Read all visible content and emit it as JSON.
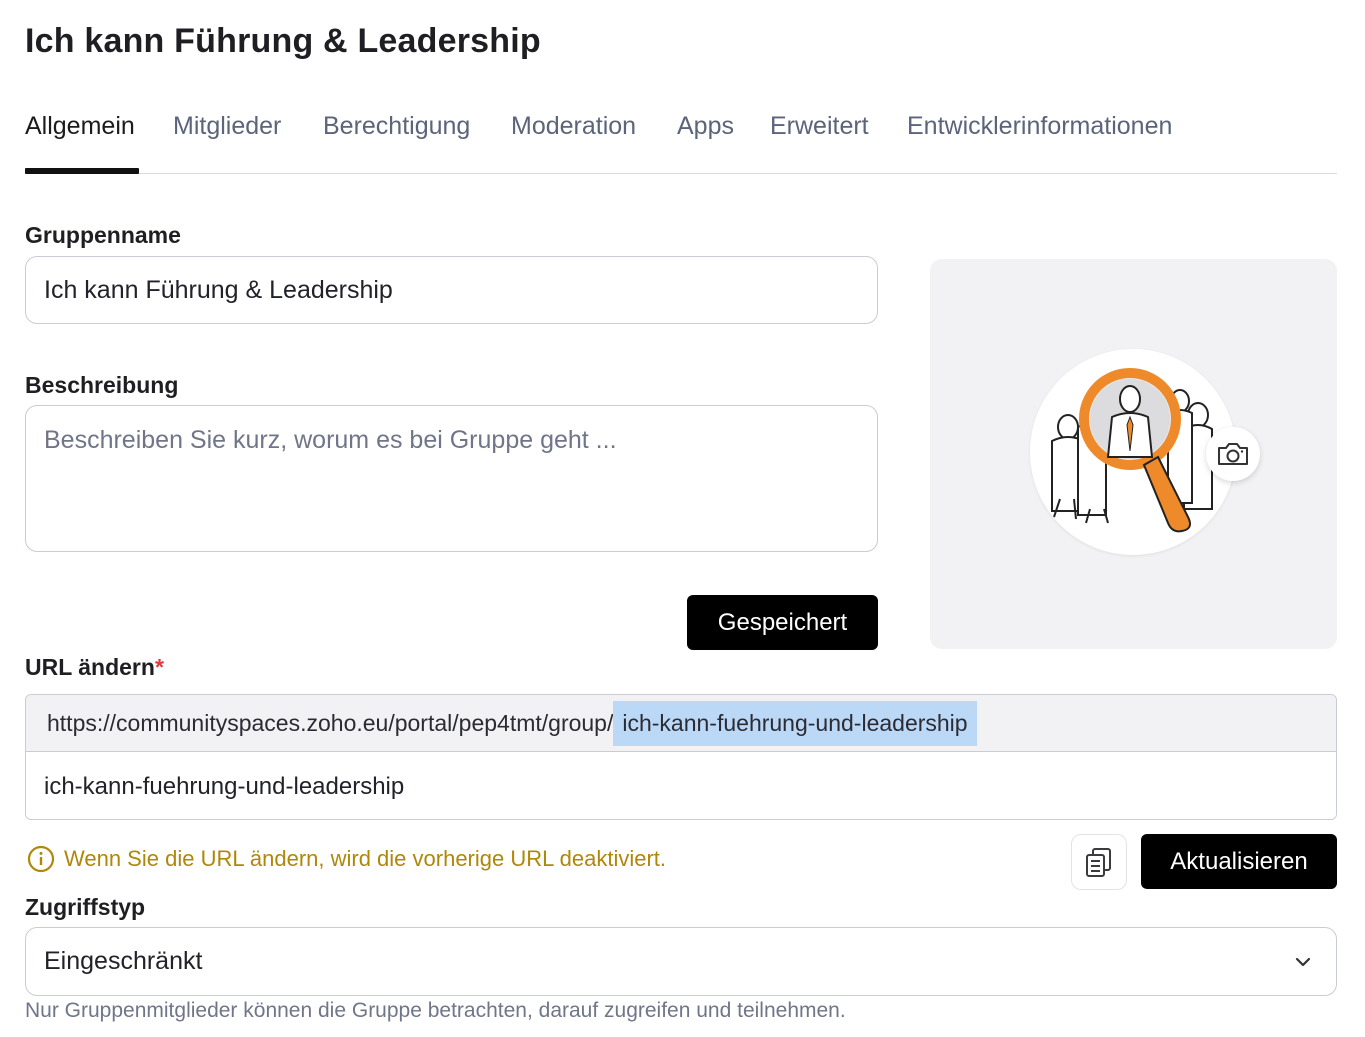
{
  "page": {
    "title": "Ich kann Führung & Leadership"
  },
  "tabs": [
    {
      "label": "Allgemein",
      "active": true
    },
    {
      "label": "Mitglieder"
    },
    {
      "label": "Berechtigung"
    },
    {
      "label": "Moderation"
    },
    {
      "label": "Apps"
    },
    {
      "label": "Erweitert"
    },
    {
      "label": "Entwicklerinformationen"
    }
  ],
  "group_name": {
    "label": "Gruppenname",
    "value": "Ich kann Führung & Leadership"
  },
  "description": {
    "label": "Beschreibung",
    "placeholder": "Beschreiben Sie kurz, worum es bei Gruppe geht ..."
  },
  "save_button": {
    "label": "Gespeichert"
  },
  "group_image": {
    "icon": "camera-icon"
  },
  "url": {
    "label": "URL ändern",
    "required_mark": "*",
    "prefix": "https://communityspaces.zoho.eu/portal/pep4tmt/group/",
    "slug_highlight": "ich-kann-fuehrung-und-leadership",
    "value": "ich-kann-fuehrung-und-leadership",
    "warning": "Wenn Sie die URL ändern, wird die vorherige URL deaktiviert.",
    "update_button": "Aktualisieren",
    "copy_icon": "copy-icon"
  },
  "access": {
    "label": "Zugriffstyp",
    "selected": "Eingeschränkt",
    "help": "Nur Gruppenmitglieder können die Gruppe betrachten, darauf zugreifen und teilnehmen."
  },
  "colors": {
    "accent": "#000000",
    "warning": "#b0870a",
    "highlight": "#bcd8f7",
    "panel_bg": "#f2f2f4",
    "magnifier": "#ee8a2a"
  }
}
